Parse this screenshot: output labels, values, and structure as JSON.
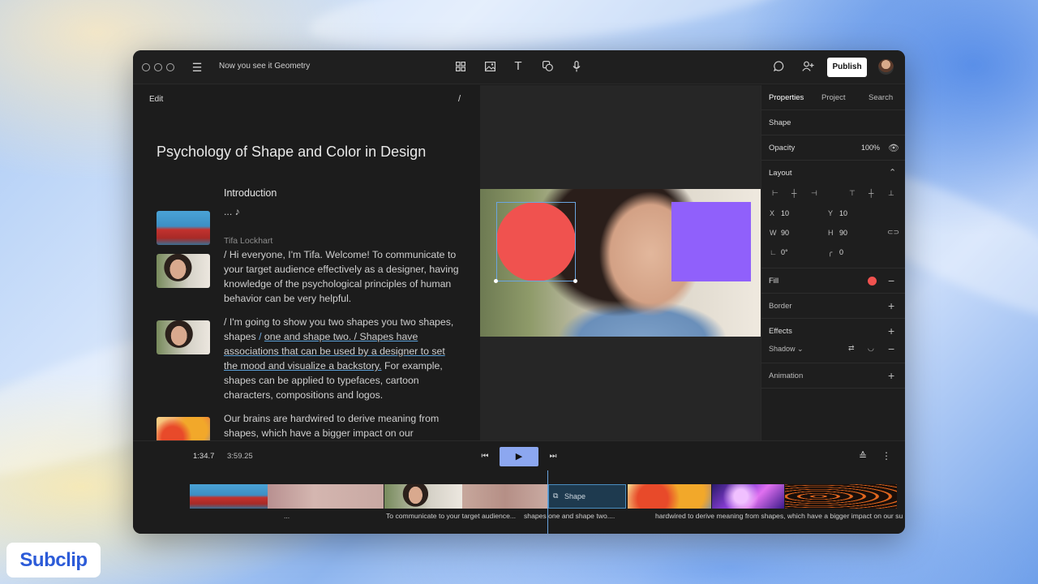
{
  "brand": {
    "logo_text": "Subclip"
  },
  "window": {
    "title": "Now you see it Geometry",
    "publish_label": "Publish",
    "toolbar_icons": [
      "grid-icon",
      "image-icon",
      "text-icon",
      "shape-icon",
      "microphone-icon"
    ],
    "right_icons": [
      "comment-icon",
      "add-user-icon",
      "avatar"
    ]
  },
  "editor": {
    "edit_label": "Edit",
    "slash_label": "/",
    "doc_title": "Psychology of Shape and Color in Design",
    "section_title": "Introduction",
    "intro_line": "... ♪",
    "speaker": "Tifa Lockhart",
    "para1": "/ Hi everyone, I'm Tifa. Welcome! To communicate to your target audience effectively as a designer, having knowledge of the psychological principles of human behavior can be very helpful.",
    "para2_a": "/ I'm going to show you two shapes you two shapes, shapes ",
    "para2_sep": "/ ",
    "para2_link": "one and shape two. / Shapes have associations that can be used by a designer to set the mood and visualize a backstory.",
    "para2_b": " For example, shapes can be applied to typefaces, cartoon characters, compositions and logos.",
    "para3": "Our brains are hardwired to derive meaning from shapes, which have a bigger impact on our"
  },
  "preview": {
    "circle_color": "#f0524f",
    "square_color": "#9060fb"
  },
  "properties": {
    "tabs": [
      "Properties",
      "Project",
      "Search"
    ],
    "active_tab": "Properties",
    "selection": "Shape",
    "opacity_label": "Opacity",
    "opacity_value": "100%",
    "layout_label": "Layout",
    "x_label": "X",
    "x_value": "10",
    "y_label": "Y",
    "y_value": "10",
    "w_label": "W",
    "w_value": "90",
    "h_label": "H",
    "h_value": "90",
    "rotation_value": "0°",
    "radius_value": "0",
    "fill_label": "Fill",
    "fill_color": "#f0524f",
    "border_label": "Border",
    "effects_label": "Effects",
    "shadow_label": "Shadow",
    "animation_label": "Animation"
  },
  "timeline": {
    "current_time": "1:34.7",
    "total_time": "3:59.25",
    "shape_clip_label": "Shape",
    "captions": [
      "...",
      "To communicate to your target audience...",
      "shapes one and shape two....",
      "hardwired to derive meaning from shapes, which have a bigger impact on our su"
    ]
  }
}
